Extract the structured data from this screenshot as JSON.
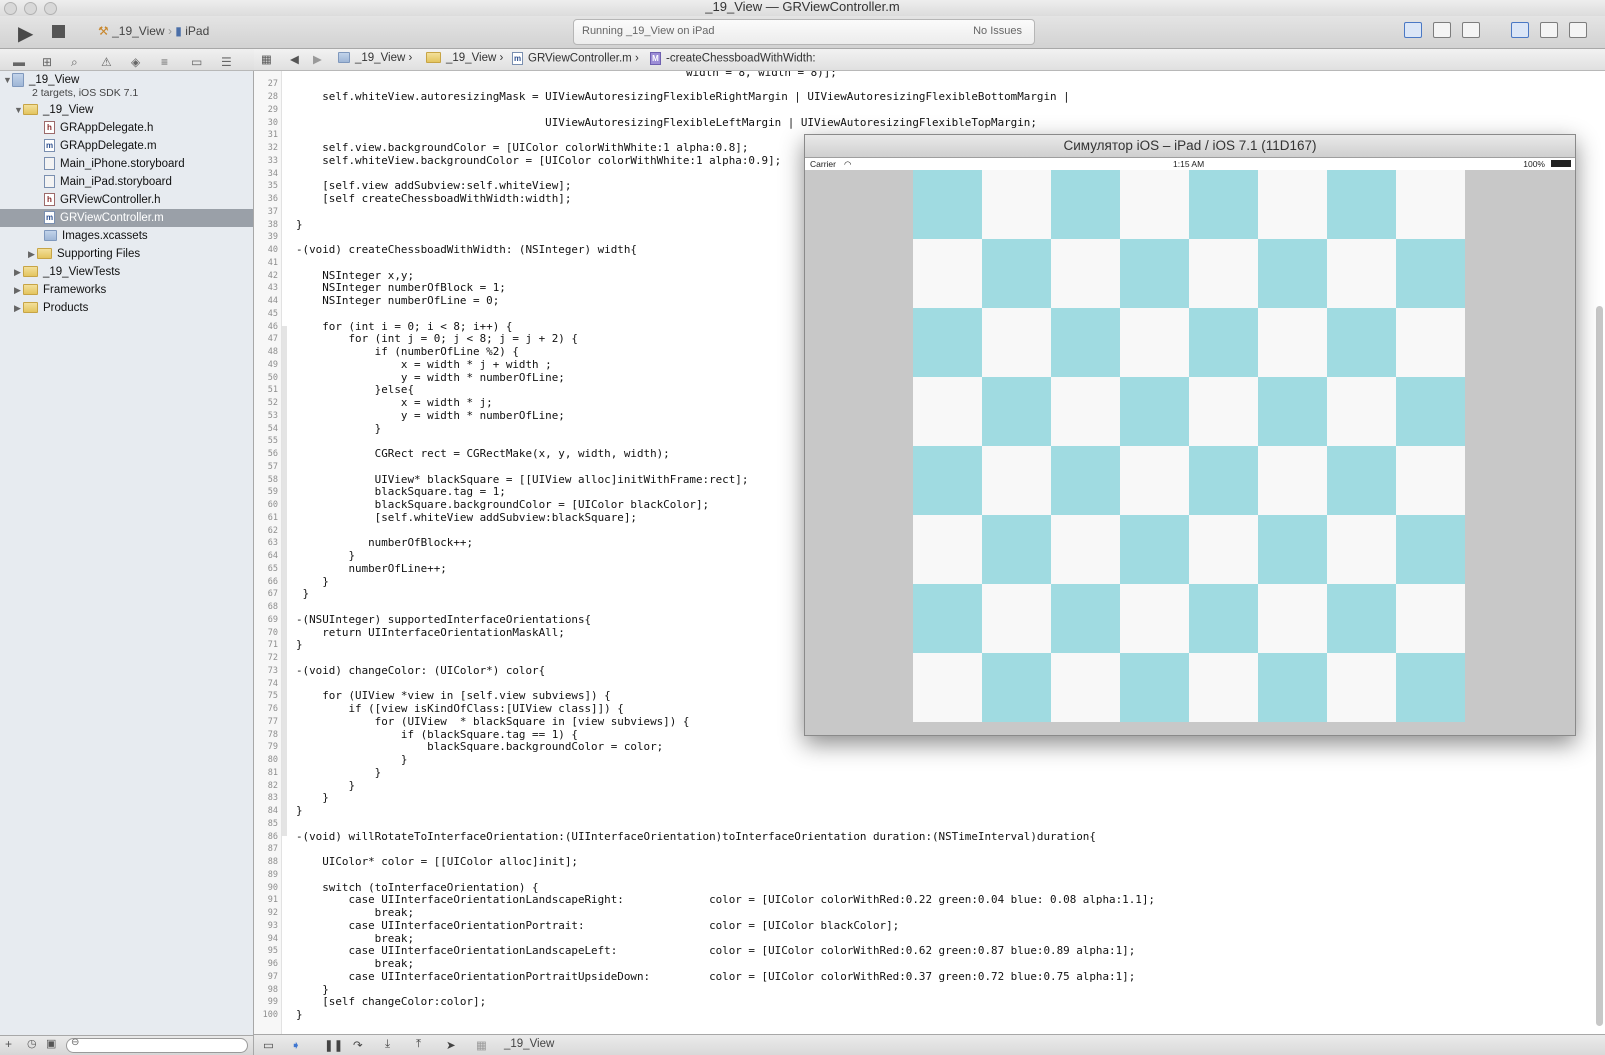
{
  "window": {
    "title_project": "_19_View",
    "title_separator": "—",
    "title_file": "GRViewController.m"
  },
  "toolbar": {
    "run_icon": "play-icon",
    "stop_icon": "stop-icon",
    "scheme": "_19_View",
    "destination": "iPad",
    "activity_status": "Running _19_View on iPad",
    "issues": "No Issues"
  },
  "navigator": {
    "project_name": "_19_View",
    "project_subtitle": "2 targets, iOS SDK 7.1",
    "items": [
      {
        "label": "_19_View",
        "kind": "folder",
        "expanded": true
      },
      {
        "label": "GRAppDelegate.h",
        "kind": "h"
      },
      {
        "label": "GRAppDelegate.m",
        "kind": "m"
      },
      {
        "label": "Main_iPhone.storyboard",
        "kind": "storyboard"
      },
      {
        "label": "Main_iPad.storyboard",
        "kind": "storyboard"
      },
      {
        "label": "GRViewController.h",
        "kind": "h"
      },
      {
        "label": "GRViewController.m",
        "kind": "m",
        "selected": true
      },
      {
        "label": "Images.xcassets",
        "kind": "assets"
      },
      {
        "label": "Supporting Files",
        "kind": "folder",
        "expanded": false
      },
      {
        "label": "_19_ViewTests",
        "kind": "folder",
        "expanded": false
      },
      {
        "label": "Frameworks",
        "kind": "folder",
        "expanded": false
      },
      {
        "label": "Products",
        "kind": "folder",
        "expanded": false
      }
    ]
  },
  "jumpbar": {
    "crumbs": [
      "_19_View",
      "_19_View",
      "GRViewController.m",
      "-createChessboadWithWidth:"
    ]
  },
  "editor": {
    "first_line_fragment": "width = 8, width = 8)];",
    "lines": [
      {
        "n": "28",
        "t": "    self.whiteView.autoresizingMask = UIViewAutoresizingFlexibleRightMargin | UIViewAutoresizingFlexibleBottomMargin |"
      },
      {
        "n": "30",
        "t": "                                      UIViewAutoresizingFlexibleLeftMargin | UIViewAutoresizingFlexibleTopMargin;"
      },
      {
        "n": "32",
        "t": "    self.view.backgroundColor = [UIColor colorWithWhite:1 alpha:0.8];"
      },
      {
        "n": "33",
        "t": "    self.whiteView.backgroundColor = [UIColor colorWithWhite:1 alpha:0.9];"
      },
      {
        "n": "35",
        "t": "    [self.view addSubview:self.whiteView];"
      },
      {
        "n": "36",
        "t": "    [self createChessboadWithWidth:width];"
      },
      {
        "n": "38",
        "t": "}"
      },
      {
        "n": "40",
        "t": "-(void) createChessboadWithWidth: (NSInteger) width{"
      },
      {
        "n": "42",
        "t": "    NSInteger x,y;"
      },
      {
        "n": "43",
        "t": "    NSInteger numberOfBlock = 1;"
      },
      {
        "n": "44",
        "t": "    NSInteger numberOfLine = 0;"
      },
      {
        "n": "46",
        "t": "    for (int i = 0; i < 8; i++) {"
      },
      {
        "n": "47",
        "t": "        for (int j = 0; j < 8; j = j + 2) {"
      },
      {
        "n": "48",
        "t": "            if (numberOfLine %2) {"
      },
      {
        "n": "49",
        "t": "                x = width * j + width ;"
      },
      {
        "n": "50",
        "t": "                y = width * numberOfLine;"
      },
      {
        "n": "51",
        "t": "            }else{"
      },
      {
        "n": "52",
        "t": "                x = width * j;"
      },
      {
        "n": "53",
        "t": "                y = width * numberOfLine;"
      },
      {
        "n": "54",
        "t": "            }"
      },
      {
        "n": "56",
        "t": "            CGRect rect = CGRectMake(x, y, width, width);"
      },
      {
        "n": "58",
        "t": "            UIView* blackSquare = [[UIView alloc]initWithFrame:rect];"
      },
      {
        "n": "59",
        "t": "            blackSquare.tag = 1;"
      },
      {
        "n": "60",
        "t": "            blackSquare.backgroundColor = [UIColor blackColor];"
      },
      {
        "n": "61",
        "t": "            [self.whiteView addSubview:blackSquare];"
      },
      {
        "n": "63",
        "t": "           numberOfBlock++;"
      },
      {
        "n": "64",
        "t": "        }"
      },
      {
        "n": "65",
        "t": "        numberOfLine++;"
      },
      {
        "n": "66",
        "t": "    }"
      },
      {
        "n": "67",
        "t": " }"
      },
      {
        "n": "69",
        "t": "-(NSUInteger) supportedInterfaceOrientations{"
      },
      {
        "n": "70",
        "t": "    return UIInterfaceOrientationMaskAll;"
      },
      {
        "n": "71",
        "t": "}"
      },
      {
        "n": "73",
        "t": "-(void) changeColor: (UIColor*) color{"
      },
      {
        "n": "75",
        "t": "    for (UIView *view in [self.view subviews]) {"
      },
      {
        "n": "76",
        "t": "        if ([view isKindOfClass:[UIView class]]) {"
      },
      {
        "n": "77",
        "t": "            for (UIView  * blackSquare in [view subviews]) {"
      },
      {
        "n": "78",
        "t": "                if (blackSquare.tag == 1) {"
      },
      {
        "n": "79",
        "t": "                    blackSquare.backgroundColor = color;"
      },
      {
        "n": "80",
        "t": "                }"
      },
      {
        "n": "81",
        "t": "            }"
      },
      {
        "n": "82",
        "t": "        }"
      },
      {
        "n": "83",
        "t": "    }"
      },
      {
        "n": "84",
        "t": "}"
      },
      {
        "n": "86",
        "t": "-(void) willRotateToInterfaceOrientation:(UIInterfaceOrientation)toInterfaceOrientation duration:(NSTimeInterval)duration{"
      },
      {
        "n": "88",
        "t": "    UIColor* color = [[UIColor alloc]init];"
      },
      {
        "n": "90",
        "t": "    switch (toInterfaceOrientation) {"
      },
      {
        "n": "91",
        "t": "        case UIInterfaceOrientationLandscapeRight:             color = [UIColor colorWithRed:0.22 green:0.04 blue: 0.08 alpha:1.1];"
      },
      {
        "n": "92",
        "t": "            break;"
      },
      {
        "n": "93",
        "t": "        case UIInterfaceOrientationPortrait:                   color = [UIColor blackColor];"
      },
      {
        "n": "94",
        "t": "            break;"
      },
      {
        "n": "95",
        "t": "        case UIInterfaceOrientationLandscapeLeft:              color = [UIColor colorWithRed:0.62 green:0.87 blue:0.89 alpha:1];"
      },
      {
        "n": "96",
        "t": "            break;"
      },
      {
        "n": "97",
        "t": "        case UIInterfaceOrientationPortraitUpsideDown:         color = [UIColor colorWithRed:0.37 green:0.72 blue:0.75 alpha:1];"
      },
      {
        "n": "98",
        "t": "    }"
      },
      {
        "n": "99",
        "t": "    [self changeColor:color];"
      },
      {
        "n": "100",
        "t": "}"
      }
    ]
  },
  "debugbar": {
    "target": "_19_View"
  },
  "simulator": {
    "title": "Симулятор iOS – iPad / iOS 7.1 (11D167)",
    "carrier": "Carrier",
    "time": "1:15 AM",
    "battery": "100%",
    "board_size": 8,
    "square_color": "#a0dbe1",
    "light_color": "#f8f8f8"
  }
}
